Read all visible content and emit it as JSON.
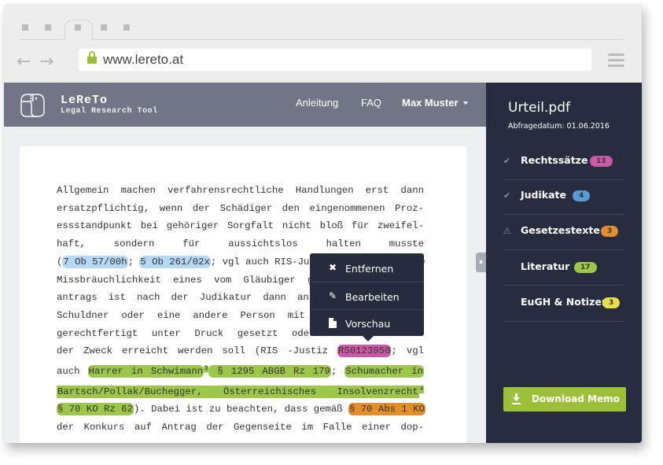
{
  "browser": {
    "url": "www.lereto.at",
    "tabs": [
      {
        "active": false
      },
      {
        "active": false
      },
      {
        "active": true
      },
      {
        "active": false
      },
      {
        "active": false
      }
    ],
    "icons": {
      "back": "arrow-left-icon",
      "forward": "arrow-right-icon",
      "lock": "lock-icon",
      "menu": "hamburger-menu-icon"
    }
  },
  "header": {
    "logo_title": "LeReTo",
    "logo_subtitle": "Legal Research Tool",
    "nav": {
      "guide": "Anleitung",
      "faq": "FAQ",
      "user": "Max Muster"
    }
  },
  "document": {
    "lines": [
      [
        {
          "t": "Allgemein machen verfahrensrechtliche Handlungen erst dann"
        }
      ],
      [
        {
          "t": "ersatzpflichtig, wenn der Schädiger den eingenommenen Proz-"
        }
      ],
      [
        {
          "t": "essstandpunkt bei gehöriger Sorgfalt nicht bloß für zweifel-"
        }
      ],
      [
        {
          "t": "haft,      sondern      für      aussichtslos      halten      musste"
        }
      ],
      [
        {
          "t": "("
        },
        {
          "t": "7 Ob 57/00h",
          "hl": "blue"
        },
        {
          "t": "; "
        },
        {
          "t": "5 Ob 261/02x",
          "hl": "blue"
        },
        {
          "t": "; vgl auch RIS-Justiz RS0022777). Die"
        }
      ],
      [
        {
          "t": "Missbräuchlichkeit eines vom Gläubiger gestellten Konkurs-"
        }
      ],
      [
        {
          "t": "antrags ist nach der Judikatur dann anzunehmen, wenn der"
        }
      ],
      [
        {
          "t": "Schuldner oder eine andere Person mit dem Antrag nicht"
        }
      ],
      [
        {
          "t": "gerechtfertigt unter Druck gesetzt oder ein unerlaubter"
        }
      ],
      [
        {
          "t": "der Zweck erreicht werden soll (RIS -Justiz "
        },
        {
          "t": "RS0123950",
          "hl": "pink"
        },
        {
          "t": "; vgl"
        }
      ],
      [
        {
          "t": "auch "
        },
        {
          "t": "Harrer in Schwimann",
          "hl": "green"
        },
        {
          "t": "3",
          "sup": true,
          "hl": "green"
        },
        {
          "t": " § 1295 ABGB Rz 179",
          "hl": "green"
        },
        {
          "t": "; "
        },
        {
          "t": "Schumacher in",
          "hl": "green"
        }
      ],
      [
        {
          "t": "Bartsch/Pollak/Buchegger, Österreichisches Insolvenzrecht",
          "hl": "green-full"
        },
        {
          "t": "4",
          "sup": true,
          "hl": "green-full"
        }
      ],
      [
        {
          "t": "§ 70 KO Rz 62",
          "hl": "green"
        },
        {
          "t": "). Dabei ist zu beachten, dass gemäß "
        },
        {
          "t": "§ 70 Abs 1 KO",
          "hl": "orange"
        }
      ],
      [
        {
          "t": "der Konkurs auf Antrag der Gegenseite im Falle einer dop-"
        }
      ]
    ]
  },
  "context_menu": {
    "items": [
      {
        "label": "Entfernen",
        "icon": "close-icon"
      },
      {
        "label": "Bearbeiten",
        "icon": "pencil-icon"
      },
      {
        "label": "Vorschau",
        "icon": "file-icon"
      }
    ]
  },
  "sidebar": {
    "file_name": "Urteil.pdf",
    "query_date": "Abfragedatum: 01.06.2016",
    "items": [
      {
        "label": "Rechtssätze",
        "count": "13",
        "status": "check",
        "color": "#c95ba6"
      },
      {
        "label": "Judikate",
        "count": "4",
        "status": "check",
        "color": "#5b9bd5"
      },
      {
        "label": "Gesetzestexte",
        "count": "3",
        "status": "warning",
        "color": "#e28e2a"
      },
      {
        "label": "Literatur",
        "count": "17",
        "status": "none",
        "color": "#9dc64a"
      },
      {
        "label": "EuGH & Notizen",
        "count": "3",
        "status": "none",
        "color": "#e4e04a"
      }
    ],
    "download_label": "Download Memo"
  },
  "colors": {
    "header_bg": "#717585",
    "sidebar_bg": "#272c3f",
    "accent_green": "#9dc038"
  }
}
